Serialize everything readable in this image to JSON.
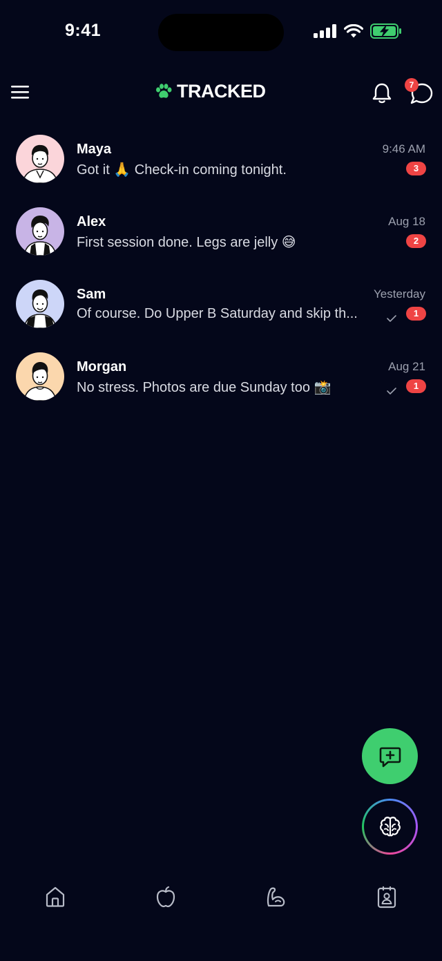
{
  "status_bar": {
    "time": "9:41",
    "icons": [
      "signal-icon",
      "wifi-icon",
      "battery-charging-icon"
    ]
  },
  "header": {
    "brand": "TRACKED",
    "brand_icon": "paw-icon",
    "notification_icon": "bell-icon",
    "messages_icon": "chat-bubble-icon",
    "messages_badge": "7"
  },
  "conversations": [
    {
      "name": "Maya",
      "time": "9:46 AM",
      "preview": "Got it 🙏 Check-in coming tonight.",
      "unread": "3",
      "read_receipt": false
    },
    {
      "name": "Alex",
      "time": "Aug 18",
      "preview": "First session done. Legs are jelly 😅",
      "unread": "2",
      "read_receipt": false
    },
    {
      "name": "Sam",
      "time": "Yesterday",
      "preview": "Of course. Do Upper B Saturday and skip th...",
      "unread": "1",
      "read_receipt": true
    },
    {
      "name": "Morgan",
      "time": "Aug 21",
      "preview": "No stress. Photos are due Sunday too 📸",
      "unread": "1",
      "read_receipt": true
    }
  ],
  "fabs": {
    "new_message_icon": "message-plus-icon",
    "ai_icon": "brain-icon"
  },
  "bottom_nav": [
    "home-icon",
    "apple-icon",
    "flexed-arm-icon",
    "clipboard-profile-icon"
  ],
  "colors": {
    "background": "#04071a",
    "accent_green": "#3fce6f",
    "badge_red": "#ef4444"
  }
}
